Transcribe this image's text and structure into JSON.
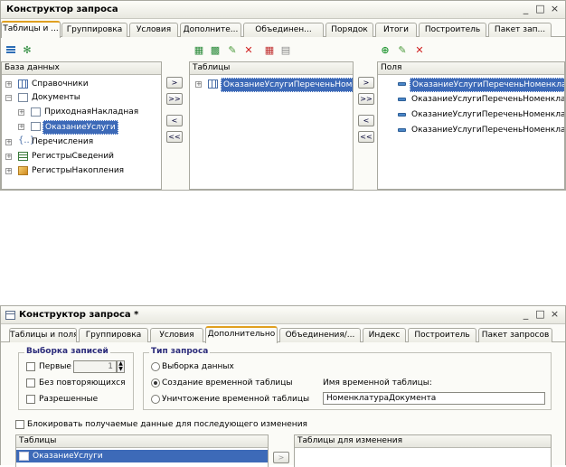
{
  "window1": {
    "title": "Конструктор запроса",
    "controls": {
      "minimize": "_",
      "maximize": "□",
      "close": "×"
    },
    "tabs": [
      "Таблицы и ...",
      "Группировка",
      "Условия",
      "Дополните...",
      "Объединен...",
      "Порядок",
      "Итоги",
      "Построитель",
      "Пакет зап..."
    ],
    "active_tab": 0,
    "database_panel": {
      "header": "База данных",
      "items": [
        {
          "label": "Справочники",
          "icon": "catalog-icon"
        },
        {
          "label": "Документы",
          "icon": "document-folder-icon"
        },
        {
          "label": "ПриходнаяНакладная",
          "icon": "document-icon"
        },
        {
          "label": "ОказаниеУслуги",
          "icon": "document-icon"
        },
        {
          "label": "Перечисления",
          "icon": "enum-icon"
        },
        {
          "label": "РегистрыСведений",
          "icon": "info-register-icon"
        },
        {
          "label": "РегистрыНакопления",
          "icon": "accumulation-register-icon"
        }
      ]
    },
    "move_buttons_left": [
      ">",
      ">>",
      "<",
      "<<"
    ],
    "tables_panel": {
      "header": "Таблицы",
      "items": [
        {
          "label": "ОказаниеУслугиПереченьНоменк"
        }
      ]
    },
    "move_buttons_right": [
      ">",
      ">>",
      "<",
      "<<"
    ],
    "fields_panel": {
      "header": "Поля",
      "items": [
        {
          "label": "ОказаниеУслугиПереченьНоменклату"
        },
        {
          "label": "ОказаниеУслугиПереченьНоменклату"
        },
        {
          "label": "ОказаниеУслугиПереченьНоменклату"
        },
        {
          "label": "ОказаниеУслугиПереченьНоменклату"
        }
      ]
    }
  },
  "window2": {
    "title": "Конструктор запроса *",
    "controls": {
      "minimize": "_",
      "maximize": "□",
      "close": "×"
    },
    "tabs": [
      "Таблицы и поля",
      "Группировка",
      "Условия",
      "Дополнительно",
      "Объединения/...",
      "Индекс",
      "Построитель",
      "Пакет запросов"
    ],
    "active_tab": 3,
    "selection_group": {
      "label": "Выборка записей",
      "first_label": "Первые",
      "first_value": "1",
      "distinct_label": "Без повторяющихся",
      "allowed_label": "Разрешенные"
    },
    "query_type_group": {
      "label": "Тип запроса",
      "options": [
        "Выборка данных",
        "Создание временной таблицы",
        "Уничтожение временной таблицы"
      ],
      "selected": 1,
      "temp_table_label": "Имя временной таблицы:",
      "temp_table_value": "НоменклатураДокумента"
    },
    "lock_label": "Блокировать получаемые данные для последующего изменения",
    "tables_panel": {
      "header": "Таблицы",
      "items": [
        {
          "label": "ОказаниеУслуги"
        }
      ]
    },
    "move_button": ">",
    "change_tables_panel": {
      "header": "Таблицы для изменения"
    }
  },
  "colors": {
    "selection": "#3d6ab8",
    "active_tab_accent": "#e0a020",
    "window_bg": "#fbfbf7"
  }
}
